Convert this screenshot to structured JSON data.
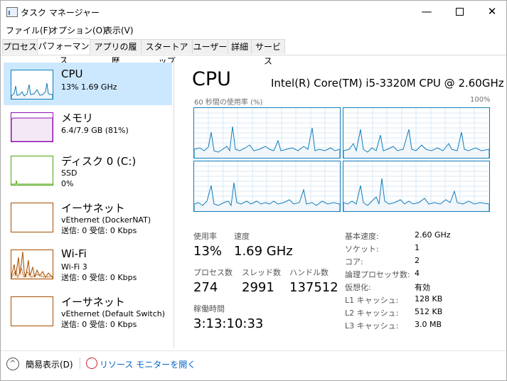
{
  "window": {
    "title": "タスク マネージャー",
    "minimize": "—",
    "close": "✕"
  },
  "menu": [
    "ファイル(F)",
    "オプション(O)",
    "表示(V)"
  ],
  "tabs": [
    "プロセス",
    "パフォーマンス",
    "アプリの履歴",
    "スタートアップ",
    "ユーザー",
    "詳細",
    "サービス"
  ],
  "active_tab": "パフォーマンス",
  "sidebar": [
    {
      "name": "CPU",
      "lines": [
        "13%  1.69 GHz"
      ],
      "color": "#117dbb"
    },
    {
      "name": "メモリ",
      "lines": [
        "6.4/7.9 GB (81%)"
      ],
      "color": "#8b12ae"
    },
    {
      "name": "ディスク 0 (C:)",
      "lines": [
        "SSD",
        "0%"
      ],
      "color": "#4da60c"
    },
    {
      "name": "イーサネット",
      "lines": [
        "vEthernet (DockerNAT)",
        "送信: 0 受信: 0 Kbps"
      ],
      "color": "#a74f01"
    },
    {
      "name": "Wi-Fi",
      "lines": [
        "Wi-Fi 3",
        "送信: 0 受信: 0 Kbps"
      ],
      "color": "#a74f01"
    },
    {
      "name": "イーサネット",
      "lines": [
        "vEthernet (Default Switch)",
        "送信: 0 受信: 0 Kbps"
      ],
      "color": "#a74f01"
    }
  ],
  "main": {
    "title": "CPU",
    "cpu_name": "Intel(R) Core(TM) i5-3320M CPU @ 2.60GHz",
    "graph_label": "60 秒間の使用率 (%)",
    "graph_max": "100%",
    "stats": {
      "utilization_label": "使用率",
      "utilization": "13%",
      "speed_label": "速度",
      "speed": "1.69 GHz",
      "processes_label": "プロセス数",
      "processes": "274",
      "threads_label": "スレッド数",
      "threads": "2991",
      "handles_label": "ハンドル数",
      "handles": "137512",
      "uptime_label": "稼働時間",
      "uptime": "3:13:10:33"
    },
    "info": [
      {
        "label": "基本速度:",
        "value": "2.60 GHz"
      },
      {
        "label": "ソケット:",
        "value": "1"
      },
      {
        "label": "コア:",
        "value": "2"
      },
      {
        "label": "論理プロセッサ数:",
        "value": "4"
      },
      {
        "label": "仮想化:",
        "value": "有効"
      },
      {
        "label": "L1 キャッシュ:",
        "value": "128 KB"
      },
      {
        "label": "L2 キャッシュ:",
        "value": "512 KB"
      },
      {
        "label": "L3 キャッシュ:",
        "value": "3.0 MB"
      }
    ]
  },
  "footer": {
    "fewer_details": "簡易表示(D)",
    "resource_monitor": "リソース モニターを開く"
  },
  "colors": {
    "cpu": "#117dbb",
    "cpu_fill": "#f1f6fa",
    "selected": "#cce8ff"
  }
}
